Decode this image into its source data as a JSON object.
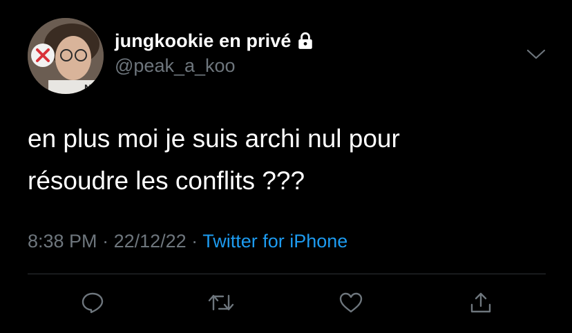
{
  "author": {
    "display_name": "jungkookie en privé",
    "handle": "@peak_a_koo",
    "protected": true,
    "avatar_icon": "avatar-photo"
  },
  "tweet": {
    "text_lines": [
      "en plus moi je suis archi nul pour",
      "résoudre les conflits ???"
    ]
  },
  "meta": {
    "time": "8:38 PM",
    "sep1": " · ",
    "date": "22/12/22",
    "sep2": " · ",
    "source": "Twitter for iPhone"
  },
  "actions": [
    "reply-icon",
    "retweet-icon",
    "like-icon",
    "share-icon"
  ],
  "colors": {
    "background": "#000000",
    "text": "#ffffff",
    "muted": "#6e767d",
    "link": "#1d9bf0",
    "divider": "#2f3336"
  }
}
